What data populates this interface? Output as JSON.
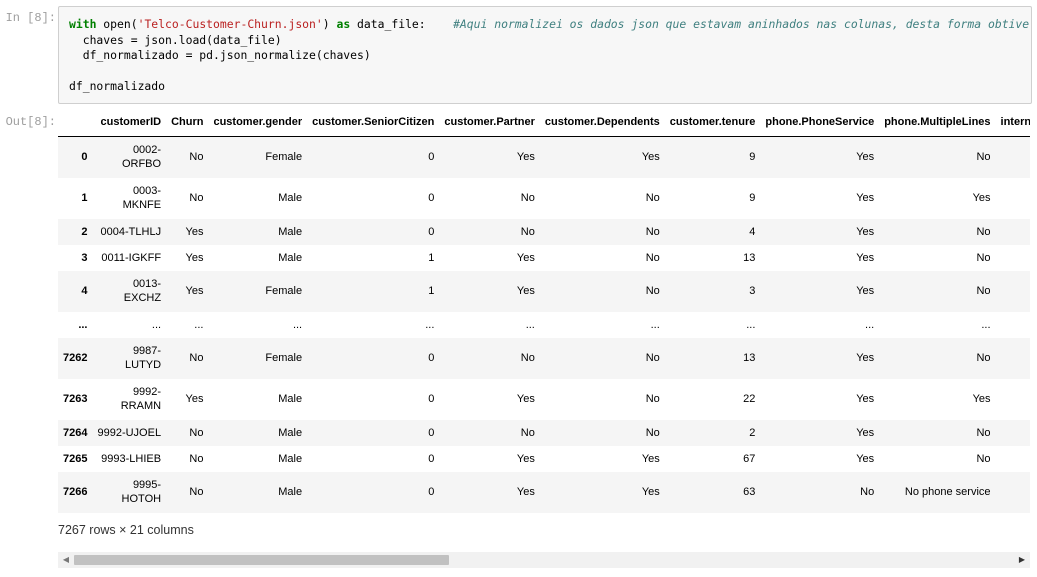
{
  "cell": {
    "in_prompt": "In [8]:",
    "out_prompt": "Out[8]:",
    "code": {
      "kw_with": "with",
      "call_open": " open(",
      "filename": "'Telco-Customer-Churn.json'",
      "close_paren": ")",
      "kw_as": "as",
      "as_target": " data_file:    ",
      "comment": "#Aqui normalizei os dados json que estavam aninhados nas colunas, desta forma obtive a separação",
      "line2": "  chaves = json.load(data_file)",
      "line3": "  df_normalizado = pd.json_normalize(chaves)",
      "line5": "df_normalizado"
    }
  },
  "dataframe": {
    "columns": [
      "customerID",
      "Churn",
      "customer.gender",
      "customer.SeniorCitizen",
      "customer.Partner",
      "customer.Dependents",
      "customer.tenure",
      "phone.PhoneService",
      "phone.MultipleLines",
      "internet.Inte"
    ],
    "rows": [
      {
        "index": "0",
        "cells": [
          "0002-ORFBO",
          "No",
          "Female",
          "0",
          "Yes",
          "Yes",
          "9",
          "Yes",
          "No",
          ""
        ]
      },
      {
        "index": "1",
        "cells": [
          "0003-MKNFE",
          "No",
          "Male",
          "0",
          "No",
          "No",
          "9",
          "Yes",
          "Yes",
          ""
        ]
      },
      {
        "index": "2",
        "cells": [
          "0004-TLHLJ",
          "Yes",
          "Male",
          "0",
          "No",
          "No",
          "4",
          "Yes",
          "No",
          ""
        ]
      },
      {
        "index": "3",
        "cells": [
          "0011-IGKFF",
          "Yes",
          "Male",
          "1",
          "Yes",
          "No",
          "13",
          "Yes",
          "No",
          ""
        ]
      },
      {
        "index": "4",
        "cells": [
          "0013-EXCHZ",
          "Yes",
          "Female",
          "1",
          "Yes",
          "No",
          "3",
          "Yes",
          "No",
          ""
        ]
      },
      {
        "index": "...",
        "cells": [
          "...",
          "...",
          "...",
          "...",
          "...",
          "...",
          "...",
          "...",
          "...",
          ""
        ]
      },
      {
        "index": "7262",
        "cells": [
          "9987-LUTYD",
          "No",
          "Female",
          "0",
          "No",
          "No",
          "13",
          "Yes",
          "No",
          ""
        ]
      },
      {
        "index": "7263",
        "cells": [
          "9992-RRAMN",
          "Yes",
          "Male",
          "0",
          "Yes",
          "No",
          "22",
          "Yes",
          "Yes",
          ""
        ]
      },
      {
        "index": "7264",
        "cells": [
          "9992-UJOEL",
          "No",
          "Male",
          "0",
          "No",
          "No",
          "2",
          "Yes",
          "No",
          ""
        ]
      },
      {
        "index": "7265",
        "cells": [
          "9993-LHIEB",
          "No",
          "Male",
          "0",
          "Yes",
          "Yes",
          "67",
          "Yes",
          "No",
          ""
        ]
      },
      {
        "index": "7266",
        "cells": [
          "9995-HOTOH",
          "No",
          "Male",
          "0",
          "Yes",
          "Yes",
          "63",
          "No",
          "No phone service",
          ""
        ]
      }
    ],
    "shape_text": "7267 rows × 21 columns"
  },
  "scrollbar": {
    "left_arrow_icon": "triangle-left-icon",
    "right_arrow_icon": "triangle-right-icon",
    "left_arrow_glyph": "◀",
    "right_arrow_glyph": "▶"
  },
  "colors": {
    "keyword": "#008000",
    "string": "#ba2121",
    "comment": "#408080",
    "code_bg": "#f7f7f7",
    "stripe": "#f5f5f5"
  }
}
